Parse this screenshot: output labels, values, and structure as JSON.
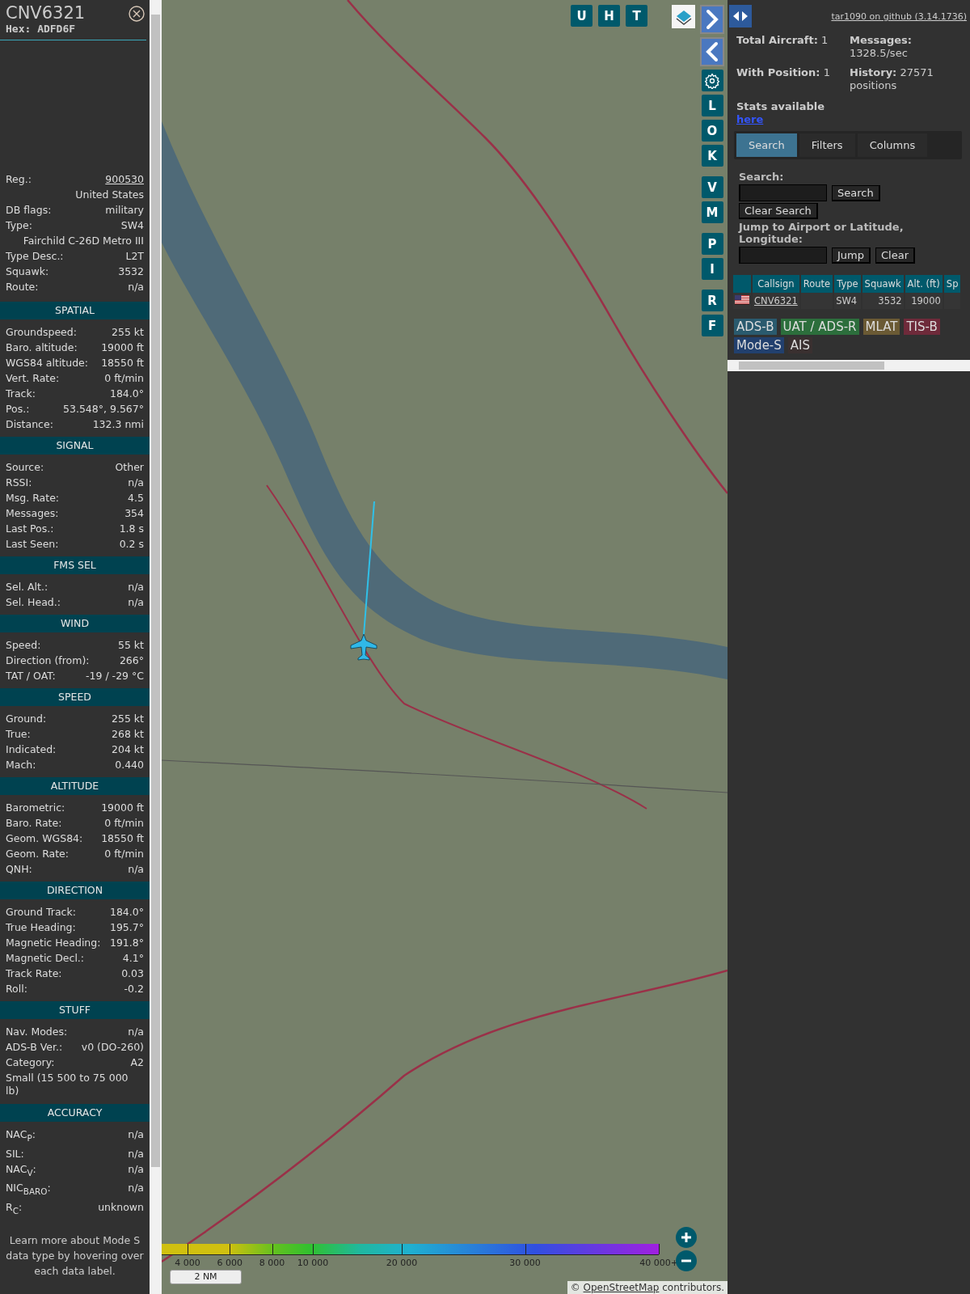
{
  "details": {
    "callsign": "CNV6321",
    "hex": "Hex: ADFD6F",
    "info": [
      {
        "kind": "link",
        "label": "Reg.:",
        "value": "900530"
      },
      {
        "kind": "right",
        "value": "United States"
      },
      {
        "kind": "pair",
        "label": "DB flags:",
        "value": "military"
      },
      {
        "kind": "pair",
        "label": "Type:",
        "value": "SW4"
      },
      {
        "kind": "right",
        "value": "Fairchild C-26D Metro III"
      },
      {
        "kind": "pair",
        "label": "Type Desc.:",
        "value": "L2T"
      },
      {
        "kind": "pair",
        "label": "Squawk:",
        "value": "3532"
      },
      {
        "kind": "pair",
        "label": "Route:",
        "value": "n/a"
      }
    ],
    "sections": [
      {
        "title": "SPATIAL",
        "rows": [
          {
            "kind": "pair",
            "label": "Groundspeed:",
            "value": "255 kt"
          },
          {
            "kind": "pair",
            "label": "Baro. altitude:",
            "value": "19000 ft"
          },
          {
            "kind": "pair",
            "label": "WGS84 altitude:",
            "value": "18550 ft"
          },
          {
            "kind": "pair",
            "label": "Vert. Rate:",
            "value": "0 ft/min"
          },
          {
            "kind": "pair",
            "label": "Track:",
            "value": "184.0°"
          },
          {
            "kind": "pair",
            "label": "Pos.:",
            "value": "53.548°, 9.567°"
          },
          {
            "kind": "pair",
            "label": "Distance:",
            "value": "132.3 nmi"
          }
        ]
      },
      {
        "title": "SIGNAL",
        "rows": [
          {
            "kind": "pair",
            "label": "Source:",
            "value": "Other"
          },
          {
            "kind": "pair",
            "label": "RSSI:",
            "value": "n/a"
          },
          {
            "kind": "pair",
            "label": "Msg. Rate:",
            "value": "4.5"
          },
          {
            "kind": "pair",
            "label": "Messages:",
            "value": "354"
          },
          {
            "kind": "pair",
            "label": "Last Pos.:",
            "value": "1.8 s"
          },
          {
            "kind": "pair",
            "label": "Last Seen:",
            "value": "0.2 s"
          }
        ]
      },
      {
        "title": "FMS SEL",
        "rows": [
          {
            "kind": "pair",
            "label": "Sel. Alt.:",
            "value": "n/a"
          },
          {
            "kind": "pair",
            "label": "Sel. Head.:",
            "value": "n/a"
          }
        ]
      },
      {
        "title": "WIND",
        "rows": [
          {
            "kind": "pair",
            "label": "Speed:",
            "value": "55 kt"
          },
          {
            "kind": "pair",
            "label": "Direction (from):",
            "value": "266°"
          },
          {
            "kind": "pair",
            "label": "TAT / OAT:",
            "value": "-19 / -29 °C"
          }
        ]
      },
      {
        "title": "SPEED",
        "rows": [
          {
            "kind": "pair",
            "label": "Ground:",
            "value": "255 kt"
          },
          {
            "kind": "pair",
            "label": "True:",
            "value": "268 kt"
          },
          {
            "kind": "pair",
            "label": "Indicated:",
            "value": "204 kt"
          },
          {
            "kind": "pair",
            "label": "Mach:",
            "value": "0.440"
          }
        ]
      },
      {
        "title": "ALTITUDE",
        "rows": [
          {
            "kind": "pair",
            "label": "Barometric:",
            "value": "19000 ft"
          },
          {
            "kind": "pair",
            "label": "Baro. Rate:",
            "value": "0 ft/min"
          },
          {
            "kind": "pair",
            "label": "Geom. WGS84:",
            "value": "18550 ft"
          },
          {
            "kind": "pair",
            "label": "Geom. Rate:",
            "value": "0 ft/min"
          },
          {
            "kind": "pair",
            "label": "QNH:",
            "value": "n/a"
          }
        ]
      },
      {
        "title": "DIRECTION",
        "rows": [
          {
            "kind": "pair",
            "label": "Ground Track:",
            "value": "184.0°"
          },
          {
            "kind": "pair",
            "label": "True Heading:",
            "value": "195.7°"
          },
          {
            "kind": "pair",
            "label": "Magnetic Heading:",
            "value": "191.8°"
          },
          {
            "kind": "pair",
            "label": "Magnetic Decl.:",
            "value": "4.1°"
          },
          {
            "kind": "pair",
            "label": "Track Rate:",
            "value": "0.03"
          },
          {
            "kind": "pair",
            "label": "Roll:",
            "value": "-0.2"
          }
        ]
      },
      {
        "title": "STUFF",
        "rows": [
          {
            "kind": "pair",
            "label": "Nav. Modes:",
            "value": "n/a"
          },
          {
            "kind": "pair",
            "label": "ADS-B Ver.:",
            "value": "v0 (DO-260)"
          },
          {
            "kind": "pair",
            "label": "Category:",
            "value": "A2"
          },
          {
            "kind": "wrap",
            "value": "Small (15 500 to 75 000 lb)"
          }
        ]
      },
      {
        "title": "ACCURACY",
        "rows": [
          {
            "kind": "pair",
            "label": "NAC$_{P}$:",
            "value": "n/a"
          },
          {
            "kind": "pair",
            "label": "SIL:",
            "value": "n/a"
          },
          {
            "kind": "pair",
            "label": "NAC$_{V}$:",
            "value": "n/a"
          },
          {
            "kind": "pair",
            "label": "NIC$_{BARO}$:",
            "value": "n/a"
          },
          {
            "kind": "pair",
            "label": "R$_{C}$:",
            "value": "unknown"
          }
        ]
      }
    ],
    "note": "Learn more about Mode S data type by hovering over each data label."
  },
  "map": {
    "top_buttons": [
      "U",
      "H",
      "T"
    ],
    "side_groups": [
      [
        {
          "kind": "next"
        },
        {
          "kind": "prev"
        },
        {
          "kind": "gear"
        },
        {
          "kind": "letter",
          "label": "L"
        },
        {
          "kind": "letter",
          "label": "O"
        },
        {
          "kind": "letter",
          "label": "K"
        }
      ],
      [
        {
          "kind": "letter",
          "label": "V"
        },
        {
          "kind": "letter",
          "label": "M"
        }
      ],
      [
        {
          "kind": "letter",
          "label": "P"
        },
        {
          "kind": "letter",
          "label": "I"
        }
      ],
      [
        {
          "kind": "letter",
          "label": "R"
        },
        {
          "kind": "letter",
          "label": "F"
        }
      ]
    ],
    "altitude_legend": [
      "4 000",
      "6 000",
      "8 000",
      "10 000",
      "20 000",
      "30 000",
      "40 000+"
    ],
    "scale": "2 NM",
    "attribution_symbol": "©",
    "attribution_link": "OpenStreetMap",
    "attribution_text": "contributors."
  },
  "sidebar": {
    "version_link": "tar1090 on github (3.14.1736)",
    "stats": [
      {
        "label": "Total Aircraft:",
        "value": "1"
      },
      {
        "label": "Messages:",
        "value": "1328.5/sec"
      },
      {
        "label": "With Position:",
        "value": "1"
      },
      {
        "label": "History:",
        "value": "27571 positions"
      }
    ],
    "stats_note": "Stats available",
    "stats_link": "here",
    "tabs": [
      {
        "label": "Search",
        "selected": true
      },
      {
        "label": "Filters",
        "selected": false
      },
      {
        "label": "Columns",
        "selected": false
      }
    ],
    "search_label": "Search:",
    "search_button": "Search",
    "clear_search_button": "Clear Search",
    "jump_label": "Jump to Airport or Latitude, Longitude:",
    "jump_button": "Jump",
    "clear_button": "Clear",
    "table": {
      "columns": [
        "",
        "Callsign",
        "Route",
        "Type",
        "Squawk",
        "Alt. (ft)",
        "Sp"
      ],
      "rows": [
        {
          "callsign": "CNV6321",
          "route": "",
          "type": "SW4",
          "squawk": "3532",
          "altitude": "19000"
        }
      ]
    },
    "legend": [
      {
        "label": "ADS-B",
        "color": "#2a5a6e"
      },
      {
        "label": "UAT / ADS-R",
        "color": "#2c6e3c"
      },
      {
        "label": "MLAT",
        "color": "#6b5a34"
      },
      {
        "label": "TIS-B",
        "color": "#6e2a3a"
      },
      {
        "label": "Mode-S",
        "color": "#22406e"
      },
      {
        "label": "AIS",
        "color": "#3a3030"
      }
    ]
  }
}
